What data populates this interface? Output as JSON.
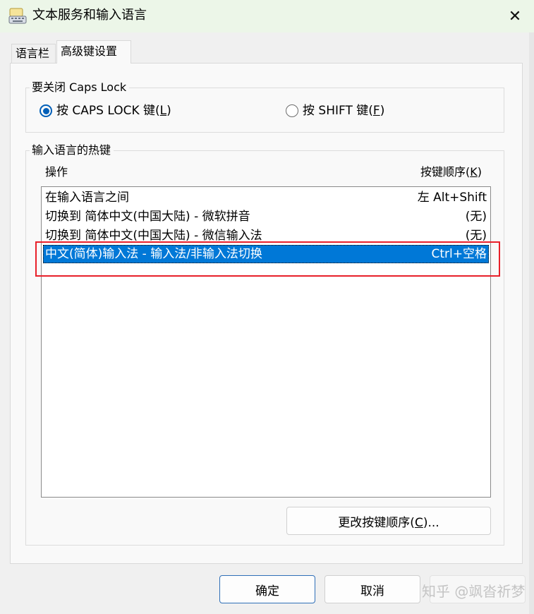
{
  "window": {
    "title": "文本服务和输入语言",
    "close_symbol": "✕"
  },
  "tabs": [
    {
      "label": "语言栏",
      "active": false
    },
    {
      "label": "高级键设置",
      "active": true
    }
  ],
  "caps_lock_group": {
    "label": "要关闭 Caps Lock",
    "options": [
      {
        "label_prefix": "按 CAPS LOCK 键(",
        "mnemonic": "L",
        "label_suffix": ")",
        "checked": true
      },
      {
        "label_prefix": "按 SHIFT 键(",
        "mnemonic": "F",
        "label_suffix": ")",
        "checked": false
      }
    ]
  },
  "hotkey_group": {
    "label": "输入语言的热键",
    "col_action": "操作",
    "col_keys_prefix": "按键顺序(",
    "col_keys_mnemonic": "K",
    "col_keys_suffix": ")",
    "rows": [
      {
        "action": "在输入语言之间",
        "keys": "左 Alt+Shift",
        "selected": false
      },
      {
        "action": "切换到 简体中文(中国大陆) - 微软拼音",
        "keys": "(无)",
        "selected": false
      },
      {
        "action": "切换到 简体中文(中国大陆) - 微信输入法",
        "keys": "(无)",
        "selected": false
      },
      {
        "action": "中文(简体)输入法 - 输入法/非输入法切换",
        "keys": "Ctrl+空格",
        "selected": true
      }
    ],
    "change_button_prefix": "更改按键顺序(",
    "change_button_mnemonic": "C",
    "change_button_suffix": ")..."
  },
  "footer": {
    "ok_label": "确定",
    "cancel_label": "取消"
  },
  "watermark": "知乎 @飒沓祈梦",
  "colors": {
    "selection": "#0078d7",
    "highlight_box": "#e8202a",
    "title_bar": "#ecf6e8"
  }
}
